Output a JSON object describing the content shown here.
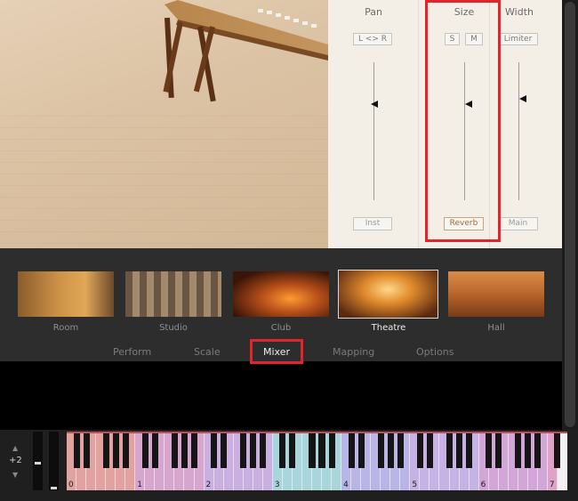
{
  "mixer": {
    "channels": [
      {
        "label": "Pan",
        "chip": "L <> R",
        "foot": "Inst"
      },
      {
        "label": "Size",
        "chips": [
          "S",
          "M"
        ],
        "foot": "Reverb"
      },
      {
        "label": "Width",
        "chip": "Limiter",
        "foot": "Main"
      }
    ]
  },
  "rooms": [
    {
      "name": "Room",
      "selected": false
    },
    {
      "name": "Studio",
      "selected": false
    },
    {
      "name": "Club",
      "selected": false
    },
    {
      "name": "Theatre",
      "selected": true
    },
    {
      "name": "Hall",
      "selected": false
    }
  ],
  "tabs": [
    {
      "label": "Perform",
      "active": false
    },
    {
      "label": "Scale",
      "active": false
    },
    {
      "label": "Mixer",
      "active": true
    },
    {
      "label": "Mapping",
      "active": false
    },
    {
      "label": "Options",
      "active": false
    }
  ],
  "keyboard": {
    "octave_shift": "+2",
    "octave_labels": [
      "0",
      "1",
      "2",
      "3",
      "4",
      "5",
      "6",
      "7"
    ],
    "up_arrow": "▲",
    "down_arrow": "▼"
  },
  "colors": {
    "highlight": "#e3242b",
    "panel": "#f3efe6",
    "dark_band": "#2d2d2d"
  }
}
